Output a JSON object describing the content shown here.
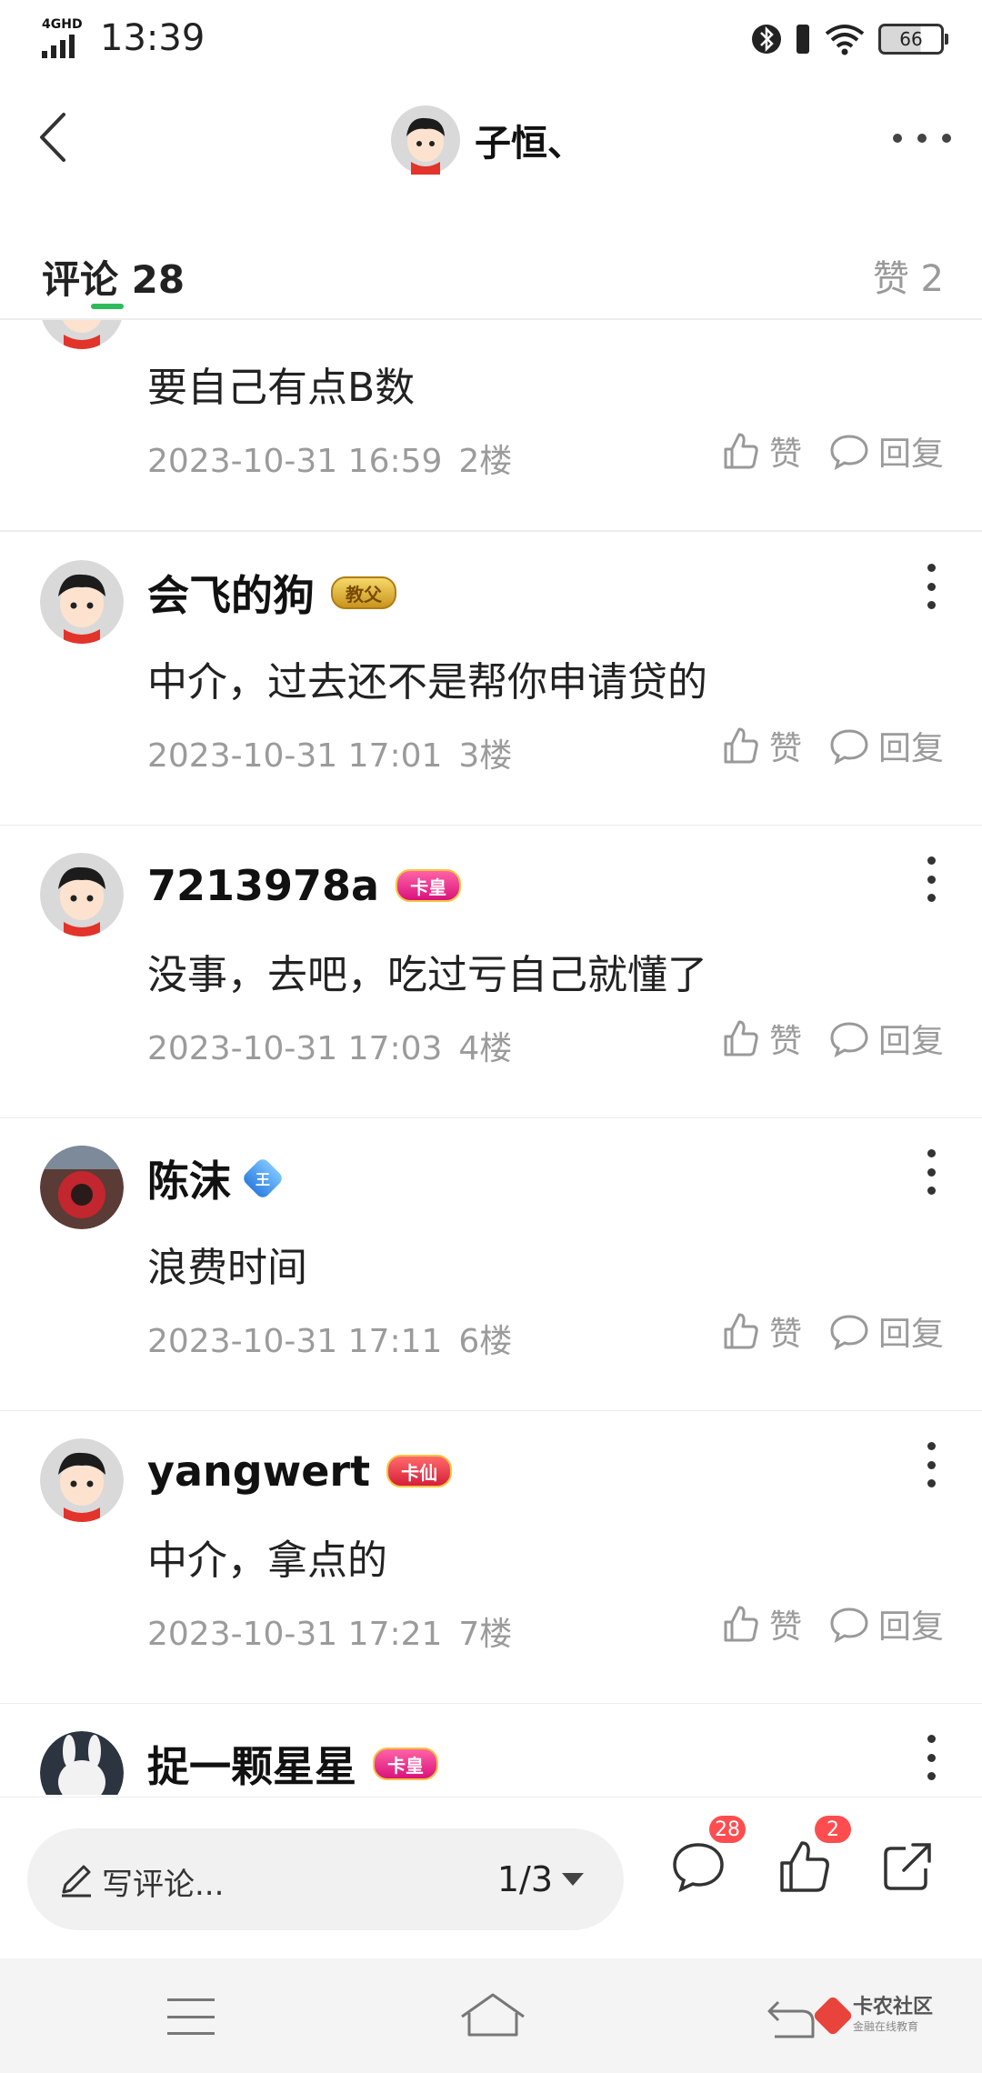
{
  "status_bar": {
    "network": "4GHD",
    "time": "13:39",
    "battery": "66"
  },
  "header": {
    "title": "子恒、"
  },
  "tabs": {
    "comments_label": "评论 28",
    "likes_label": "赞 2"
  },
  "comments": [
    {
      "name": "",
      "badge": "",
      "text": "要自己有点B数",
      "date": "2023-10-31 16:59",
      "floor": "2楼",
      "like_label": "赞",
      "reply_label": "回复"
    },
    {
      "name": "会飞的狗",
      "badge": "教父",
      "badge_style": "gold",
      "text": "中介，过去还不是帮你申请贷的",
      "date": "2023-10-31 17:01",
      "floor": "3楼",
      "like_label": "赞",
      "reply_label": "回复"
    },
    {
      "name": "7213978a",
      "badge": "卡皇",
      "badge_style": "pink",
      "text": "没事，去吧，吃过亏自己就懂了",
      "date": "2023-10-31 17:03",
      "floor": "4楼",
      "like_label": "赞",
      "reply_label": "回复"
    },
    {
      "name": "陈沫",
      "badge": "王",
      "badge_style": "blue",
      "text": "浪费时间",
      "date": "2023-10-31 17:11",
      "floor": "6楼",
      "like_label": "赞",
      "reply_label": "回复"
    },
    {
      "name": "yangwert",
      "badge": "卡仙",
      "badge_style": "red",
      "text": "中介，拿点的",
      "date": "2023-10-31 17:21",
      "floor": "7楼",
      "like_label": "赞",
      "reply_label": "回复"
    },
    {
      "name": "捉一颗星星",
      "badge": "卡皇",
      "badge_style": "pink",
      "text": "",
      "date": "",
      "floor": "",
      "like_label": "",
      "reply_label": ""
    }
  ],
  "bottom_bar": {
    "placeholder": "写评论...",
    "pager": "1/3",
    "comment_count": "28",
    "like_count": "2"
  },
  "system_nav": {
    "watermark_title": "卡农社区",
    "watermark_sub": "金融在线教育"
  },
  "colors": {
    "accent_green": "#2dbb5c",
    "badge_red": "#ff4d4f",
    "muted_text": "#9b9b9b"
  }
}
